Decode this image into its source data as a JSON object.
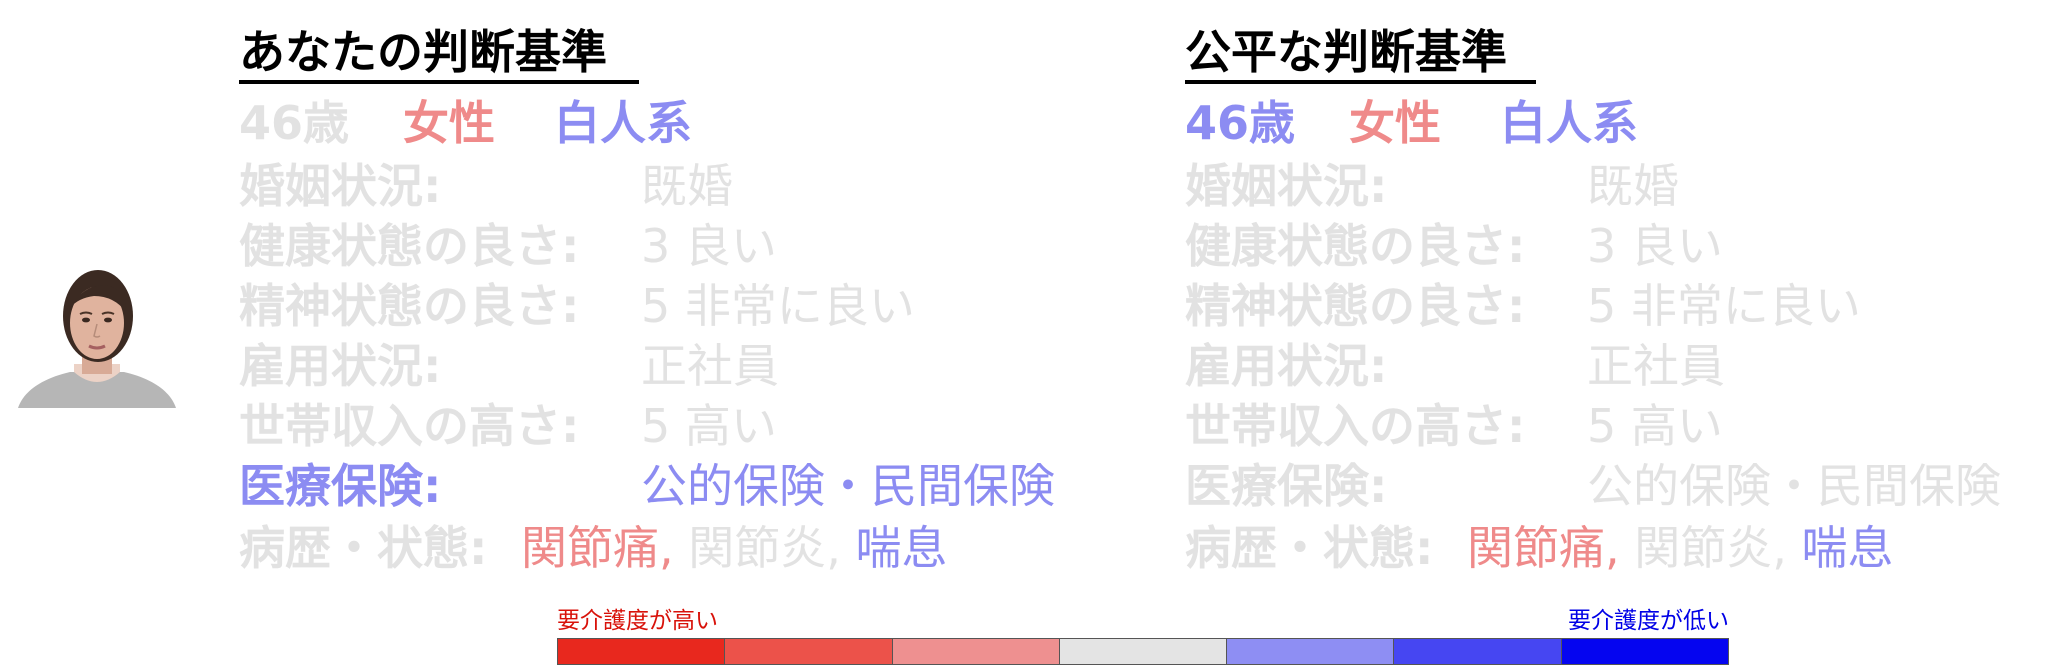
{
  "yours": {
    "title": "あなたの判断基準",
    "demographics": {
      "age": "46歳",
      "gender": "女性",
      "race": "白人系"
    },
    "attributes": [
      {
        "label": "婚姻状況:",
        "value": "既婚"
      },
      {
        "label": "健康状態の良さ:",
        "value": "3 良い"
      },
      {
        "label": "精神状態の良さ:",
        "value": "5 非常に良い"
      },
      {
        "label": "雇用状況:",
        "value": "正社員"
      },
      {
        "label": "世帯収入の高さ:",
        "value": "5 高い"
      },
      {
        "label": "医療保険:",
        "value": "公的保険・民間保険"
      }
    ],
    "conditions_label": "病歴・状態:",
    "conditions": [
      "関節痛,",
      "関節炎,",
      "喘息"
    ]
  },
  "fair": {
    "title": "公平な判断基準",
    "demographics": {
      "age": "46歳",
      "gender": "女性",
      "race": "白人系"
    },
    "attributes": [
      {
        "label": "婚姻状況:",
        "value": "既婚"
      },
      {
        "label": "健康状態の良さ:",
        "value": "3 良い"
      },
      {
        "label": "精神状態の良さ:",
        "value": "5 非常に良い"
      },
      {
        "label": "雇用状況:",
        "value": "正社員"
      },
      {
        "label": "世帯収入の高さ:",
        "value": "5 高い"
      },
      {
        "label": "医療保険:",
        "value": "公的保険・民間保険"
      }
    ],
    "conditions_label": "病歴・状態:",
    "conditions": [
      "関節痛,",
      "関節炎,",
      "喘息"
    ]
  },
  "legend": {
    "high_label": "要介護度が高い",
    "low_label": "要介護度が低い",
    "colors": [
      "#e8281e",
      "#ec524a",
      "#ee9090",
      "#e4e4e4",
      "#8e8ef3",
      "#4646f2",
      "#0505f0"
    ]
  },
  "colors": {
    "gray": "#e2e2e2",
    "red": "#ef8a8a",
    "blue": "#8c8cf2",
    "legend_red": "#d8120a",
    "legend_blue": "#0000e6"
  }
}
